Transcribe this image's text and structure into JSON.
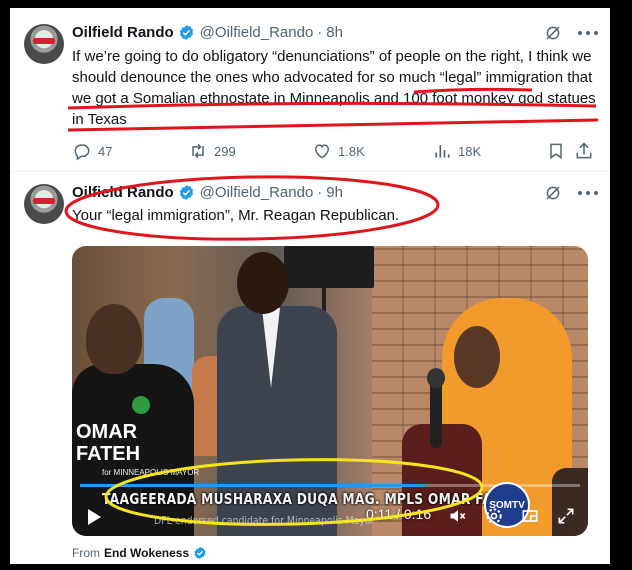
{
  "tweets": [
    {
      "name": "Oilfield Rando",
      "handle": "@Oilfield_Rando",
      "dot": "·",
      "time": "8h",
      "text": "If we’re going to do obligatory “denunciations” of people on the right, I think we should denounce the ones who advocated for so much “legal” immigration that we got a Somalian ethnostate in Minneapolis and 100 foot monkey god statues in Texas",
      "actions": {
        "replies": "47",
        "reposts": "299",
        "likes": "1.8K",
        "views": "18K"
      }
    },
    {
      "name": "Oilfield Rando",
      "handle": "@Oilfield_Rando",
      "dot": "·",
      "time": "9h",
      "text": "Your “legal immigration”, Mr. Reagan Republican.",
      "video": {
        "caption": "TAAGEERADA MUSHARAXA DUQA MAG. MPLS OMAR FATEH",
        "subcaption": "DFL-endorsed candidate for Minneapolis Mayor",
        "shirt_text": "OMAR FATEH",
        "shirt_sub": "for MINNEAPOLIS MAYOR",
        "logo": "SOMTV",
        "time_display": "0:11 / 0:16",
        "progress_fraction": 0.69
      },
      "from_prefix": "From",
      "from_account": "End Wokeness"
    }
  ],
  "colors": {
    "verified": "#1d9bf0",
    "annotation_red": "#e0141e",
    "annotation_yellow": "#f5e61c",
    "text_secondary": "#536471"
  },
  "icons": [
    "verified-badge-icon",
    "grok-icon",
    "more-icon",
    "reply-icon",
    "repost-icon",
    "like-icon",
    "views-icon",
    "bookmark-icon",
    "share-icon",
    "play-icon",
    "settings-icon",
    "mute-icon",
    "pip-icon",
    "fullscreen-icon"
  ]
}
